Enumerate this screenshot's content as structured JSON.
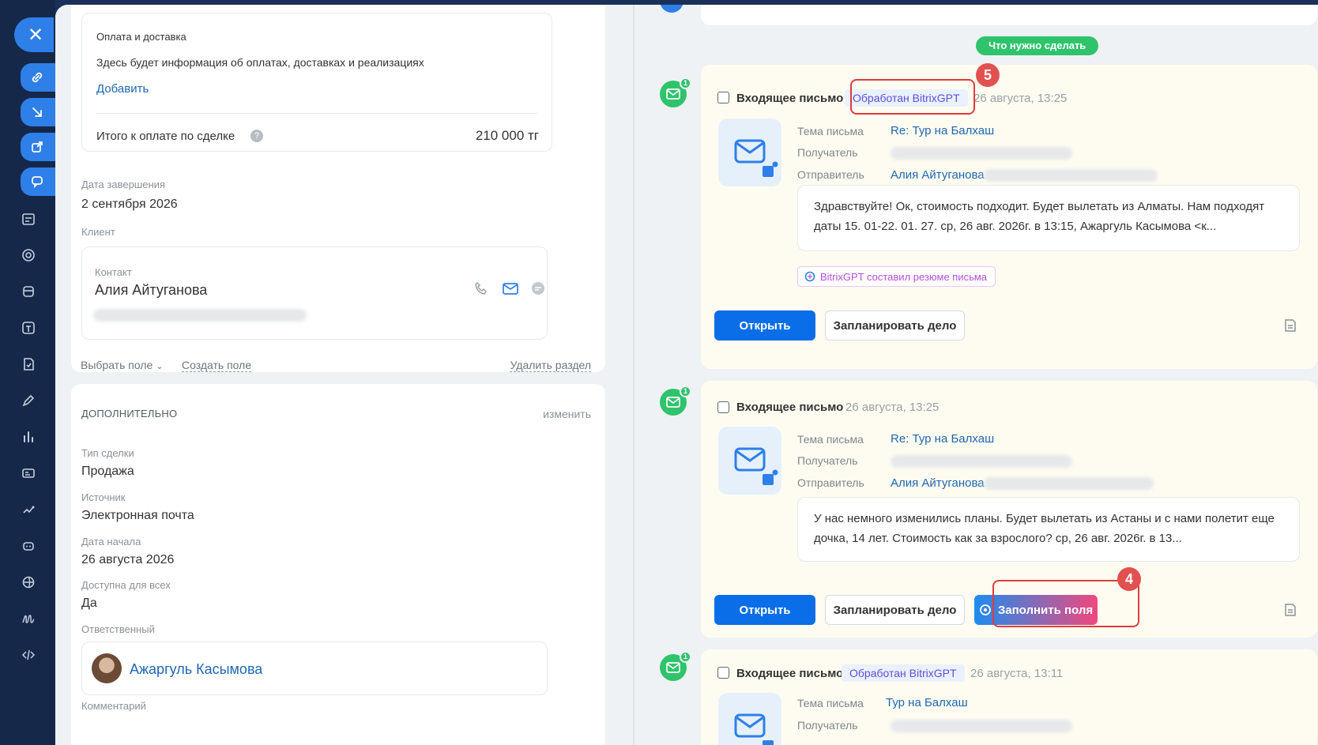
{
  "payment": {
    "title": "Оплата и доставка",
    "info": "Здесь будет информация об оплатах, доставках и реализациях",
    "add_link": "Добавить",
    "total_label": "Итого к оплате по сделке",
    "total_value": "210 000 тг"
  },
  "deal": {
    "end_date_label": "Дата завершения",
    "end_date_value": "2 сентября 2026",
    "client_label": "Клиент",
    "contact_label": "Контакт",
    "contact_name": "Алия Айтуганова",
    "select_field": "Выбрать поле",
    "create_field": "Создать поле",
    "delete_section": "Удалить раздел"
  },
  "additional": {
    "header": "ДОПОЛНИТЕЛЬНО",
    "edit_link": "изменить",
    "deal_type_label": "Тип сделки",
    "deal_type_value": "Продажа",
    "source_label": "Источник",
    "source_value": "Электронная почта",
    "start_date_label": "Дата начала",
    "start_date_value": "26 августа 2026",
    "available_label": "Доступна для всех",
    "available_value": "Да",
    "responsible_label": "Ответственный",
    "responsible_name": "Ажаргуль Касымова",
    "comment_label": "Комментарий"
  },
  "timeline": {
    "todo_pill": "Что нужно сделать",
    "field_labels": {
      "subject": "Тема письма",
      "recipient": "Получатель",
      "sender": "Отправитель"
    },
    "open_button": "Открыть",
    "plan_button": "Запланировать дело",
    "fill_button": "Заполнить поля",
    "gpt_summary": "BitrixGPT составил резюме письма",
    "emails": [
      {
        "title": "Входящее письмо",
        "badge": "Обработан BitrixGPT",
        "date": "26 августа, 13:25",
        "subject": "Re: Тур на Балхаш",
        "sender": "Алия Айтуганова",
        "body": "Здравствуйте! Ок, стоимость подходит. Будет вылетать из Алматы. Нам подходят даты 15. 01-22. 01. 27. ср, 26 авг. 2026г. в 13:15, Ажаргуль Касымова <к...",
        "badge_count": "1"
      },
      {
        "title": "Входящее письмо",
        "date": "26 августа, 13:25",
        "subject": "Re: Тур на Балхаш",
        "sender": "Алия Айтуганова",
        "body": "У нас немного изменились планы. Будет вылетать из Астаны и с нами полетит еще дочка, 14 лет. Стоимость как за взрослого? ср, 26 авг. 2026г. в 13...",
        "badge_count": "1"
      },
      {
        "title": "Входящее письмо",
        "badge": "Обработан BitrixGPT",
        "date": "26 августа, 13:11",
        "subject": "Тур на Балхаш",
        "badge_count": "1"
      }
    ]
  },
  "annotations": {
    "marker_5": "5",
    "marker_4": "4"
  },
  "colors": {
    "accent": "#0a6ee8",
    "link": "#2067b0",
    "success": "#2fc36c",
    "annotation": "#e03c3c",
    "sidebar": "#16284a"
  }
}
